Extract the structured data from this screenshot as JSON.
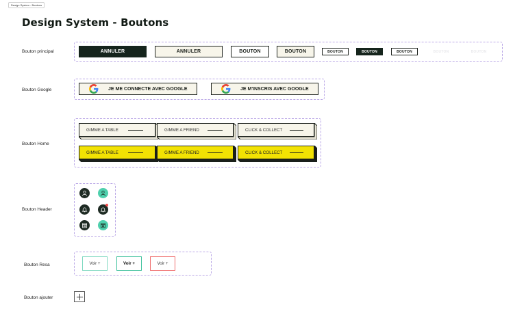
{
  "frame_tag": "Design System - Boutons",
  "title": "Design System - Boutons",
  "rows": {
    "principal": "Bouton principal",
    "google": "Bouton Google",
    "home": "Bouton Home",
    "header": "Bouton Header",
    "resa": "Bouton Resa",
    "ajouter": "Bouton ajouter"
  },
  "principal_buttons": [
    "ANNULER",
    "ANNULER",
    "BOUTON",
    "BOUTON",
    "BOUTON",
    "BOUTON",
    "BOUTON"
  ],
  "google_buttons": [
    "JE ME CONNECTE AVEC GOOGLE",
    "JE M'INSCRIS AVEC GOOGLE"
  ],
  "home_buttons": [
    "GIMME A TABLE",
    "GIMME A FRIEND",
    "CLICK & COLLECT"
  ],
  "resa_buttons": [
    "Voir +",
    "Voir +",
    "Voir +"
  ],
  "colors": {
    "dark_green": "#15241c",
    "cream": "#f7f5ea",
    "yellow": "#f2e203",
    "mint": "#4fd0ad",
    "red": "#ef4a4a",
    "dashed_border": "#b9a6e6"
  },
  "icons": [
    "user-icon",
    "bell-icon",
    "calendar-icon",
    "google-g-icon",
    "plus-icon"
  ]
}
